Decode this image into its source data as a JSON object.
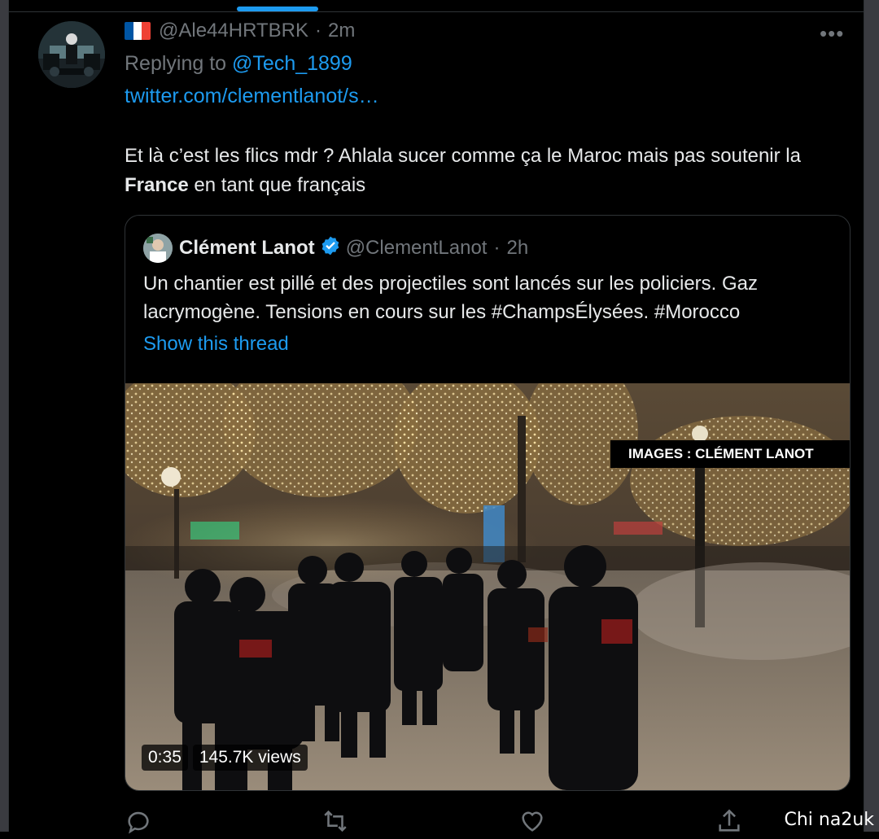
{
  "colors": {
    "accent": "#1d9bf0",
    "muted": "#71767b",
    "text": "#e7e9ea",
    "background": "#000000"
  },
  "tweet": {
    "avatar_icon": "avatar",
    "flag_icon": "france-flag-icon",
    "handle": "@Ale44HRTBRK",
    "separator": "·",
    "time": "2m",
    "more_label": "•••",
    "replying_prefix": "Replying to ",
    "replying_to": "@Tech_1899",
    "url": "twitter.com/clementlanot/s…",
    "text_before": "Et là c’est les flics mdr ? Ahlala sucer comme ça le Maroc mais pas soutenir la ",
    "text_bold": "France",
    "text_after": " en tant que français"
  },
  "quote": {
    "name": "Clément Lanot",
    "verified_icon": "verified-badge-icon",
    "handle": "@ClementLanot",
    "separator": "·",
    "time": "2h",
    "text": "Un chantier est pillé et des projectiles sont lancés sur les policiers. Gaz lacrymogène. Tensions en cours sur les #ChampsÉlysées. #Morocco",
    "show_thread": "Show this thread",
    "media": {
      "watermark": "IMAGES : CLÉMENT LANOT",
      "duration": "0:35",
      "views": "145.7K views"
    }
  },
  "actions": [
    {
      "icon": "reply-icon"
    },
    {
      "icon": "retweet-icon"
    },
    {
      "icon": "like-icon"
    },
    {
      "icon": "share-icon"
    }
  ],
  "site_watermark": "Chi na2uk"
}
